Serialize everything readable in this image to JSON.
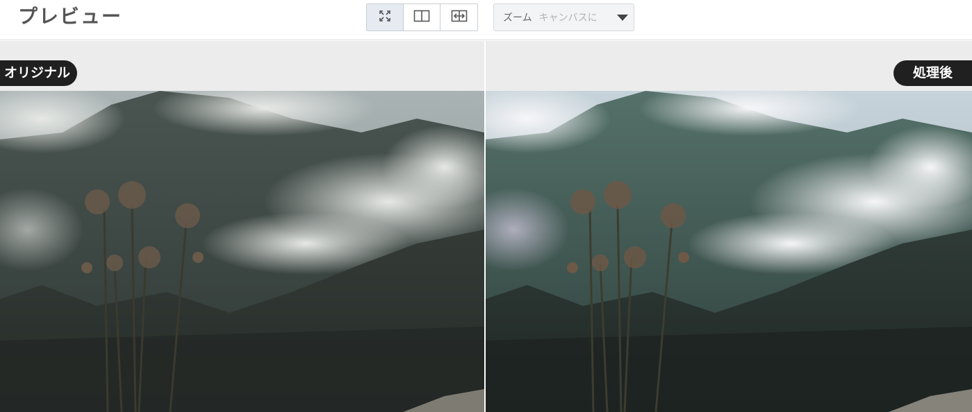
{
  "header": {
    "title": "プレビュー",
    "view_modes": [
      {
        "name": "fit-to-canvas",
        "icon": "fit-expand-icon",
        "active": true
      },
      {
        "name": "split-view",
        "icon": "split-view-icon",
        "active": false
      },
      {
        "name": "side-by-side",
        "icon": "compare-arrows-icon",
        "active": false
      }
    ],
    "zoom": {
      "label": "ズーム",
      "value": "キャンバスに"
    }
  },
  "panels": {
    "original_label": "オリジナル",
    "processed_label": "処理後"
  },
  "colors": {
    "badge_bg": "#202020",
    "panel_bg": "#ececec",
    "active_view_bg": "#e6ebf2"
  }
}
